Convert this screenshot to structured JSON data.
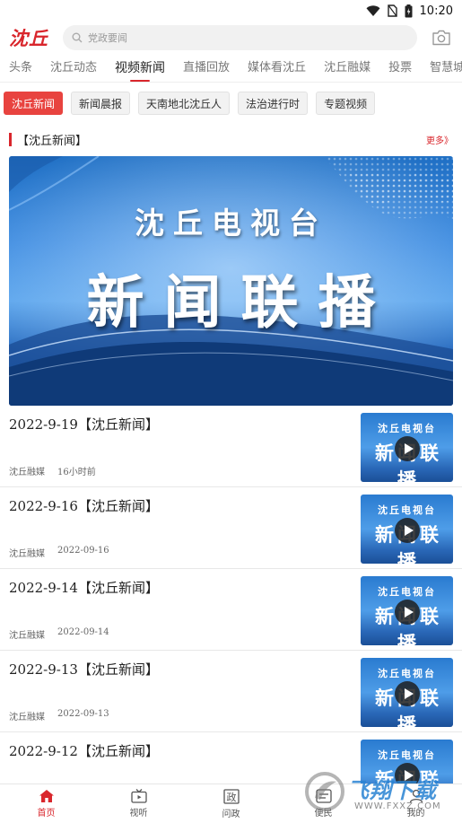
{
  "status": {
    "time": "10:20"
  },
  "header": {
    "logo": "沈丘",
    "search_placeholder": "党政要闻"
  },
  "tabs": [
    {
      "label": "头条",
      "active": false
    },
    {
      "label": "沈丘动态",
      "active": false
    },
    {
      "label": "视频新闻",
      "active": true
    },
    {
      "label": "直播回放",
      "active": false
    },
    {
      "label": "媒体看沈丘",
      "active": false
    },
    {
      "label": "沈丘融媒",
      "active": false
    },
    {
      "label": "投票",
      "active": false
    },
    {
      "label": "智慧城市",
      "active": false
    }
  ],
  "subtabs": [
    {
      "label": "沈丘新闻",
      "active": true
    },
    {
      "label": "新闻晨报",
      "active": false
    },
    {
      "label": "天南地北沈丘人",
      "active": false
    },
    {
      "label": "法治进行时",
      "active": false
    },
    {
      "label": "专题视频",
      "active": false
    }
  ],
  "section": {
    "title": "【沈丘新闻】",
    "more": "更多》"
  },
  "banner": {
    "line1": "沈丘电视台",
    "line2": "新闻联播"
  },
  "thumb": {
    "line1": "沈丘电视台",
    "line2": "新闻联播"
  },
  "news": [
    {
      "title": "2022-9-19【沈丘新闻】",
      "source": "沈丘融媒",
      "time": "16小时前"
    },
    {
      "title": "2022-9-16【沈丘新闻】",
      "source": "沈丘融媒",
      "time": "2022-09-16"
    },
    {
      "title": "2022-9-14【沈丘新闻】",
      "source": "沈丘融媒",
      "time": "2022-09-14"
    },
    {
      "title": "2022-9-13【沈丘新闻】",
      "source": "沈丘融媒",
      "time": "2022-09-13"
    },
    {
      "title": "2022-9-12【沈丘新闻】",
      "source": "",
      "time": ""
    }
  ],
  "bottom_nav": [
    {
      "label": "首页",
      "icon": "home-icon",
      "active": true
    },
    {
      "label": "视听",
      "icon": "tv-icon",
      "active": false
    },
    {
      "label": "问政",
      "icon": "politics-icon",
      "active": false
    },
    {
      "label": "便民",
      "icon": "service-icon",
      "active": false
    },
    {
      "label": "我的",
      "icon": "profile-icon",
      "active": false
    }
  ],
  "watermark": {
    "text": "飞翔下载",
    "url": "WWW.FXXZ.COM"
  },
  "colors": {
    "accent": "#d9262c",
    "chip_active": "#e8433f"
  }
}
